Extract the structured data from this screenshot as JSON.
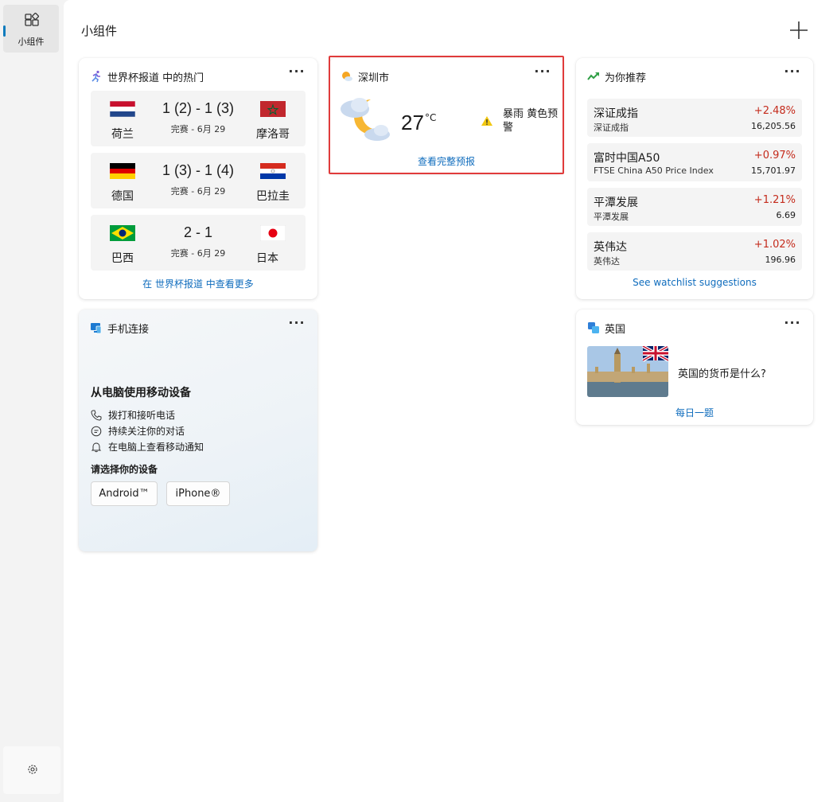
{
  "rail": {
    "tab_label": "小组件",
    "tab_icon": "widgets-icon",
    "settings_icon": "gear-icon"
  },
  "main": {
    "title": "小组件",
    "add_icon": "plus-icon"
  },
  "sports": {
    "title": "世界杯报道 中的热门",
    "more": "···",
    "matches": [
      {
        "home": "荷兰",
        "away": "摩洛哥",
        "score": "1 (2) - 1 (3)",
        "status": "完赛 - 6月 29"
      },
      {
        "home": "德国",
        "away": "巴拉圭",
        "score": "1 (3) - 1 (4)",
        "status": "完赛 - 6月 29"
      },
      {
        "home": "巴西",
        "away": "日本",
        "score": "2 - 1",
        "status": "完赛 - 6月 29"
      }
    ],
    "link": "在 世界杯报道 中查看更多"
  },
  "weather": {
    "city": "深圳市",
    "more": "···",
    "temp": "27",
    "unit": "°C",
    "alert": "暴雨 黄色预警",
    "link": "查看完整预报"
  },
  "stocks": {
    "title": "为你推荐",
    "more": "···",
    "items": [
      {
        "name": "深证成指",
        "sub": "深证成指",
        "change": "+2.48%",
        "price": "16,205.56"
      },
      {
        "name": "富时中国A50",
        "sub": "FTSE China A50 Price Index",
        "change": "+0.97%",
        "price": "15,701.97"
      },
      {
        "name": "平潭发展",
        "sub": "平潭发展",
        "change": "+1.21%",
        "price": "6.69"
      },
      {
        "name": "英伟达",
        "sub": "英伟达",
        "change": "+1.02%",
        "price": "196.96"
      }
    ],
    "link": "See watchlist suggestions"
  },
  "phone": {
    "title": "手机连接",
    "more": "···",
    "headline": "从电脑使用移动设备",
    "features": [
      "拨打和接听电话",
      "持续关注你的对话",
      "在电脑上查看移动通知"
    ],
    "choose": "请选择你的设备",
    "android": "Android™",
    "iphone": "iPhone®"
  },
  "quiz": {
    "title": "英国",
    "more": "···",
    "question": "英国的货币是什么?",
    "link": "每日一题"
  },
  "colors": {
    "accent": "#0f6cbd",
    "positive_change": "#c42b1c",
    "selection_border": "#e03b3b"
  }
}
